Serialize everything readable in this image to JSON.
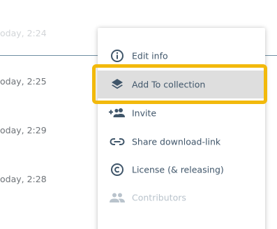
{
  "background_list": {
    "rows": [
      {
        "time": "oday, 2:24"
      },
      {
        "time": "oday, 2:25"
      },
      {
        "time": "oday, 2:29"
      },
      {
        "time": "oday, 2:28"
      }
    ]
  },
  "menu": {
    "items": [
      {
        "label": "Edit info",
        "icon": "info-circle-icon"
      },
      {
        "label": "Add To collection",
        "icon": "layers-icon"
      },
      {
        "label": "Invite",
        "icon": "add-people-icon"
      },
      {
        "label": "Share download-link",
        "icon": "link-icon"
      },
      {
        "label": "License (& releasing)",
        "icon": "copyright-icon"
      },
      {
        "label": "Contributors",
        "icon": "people-icon"
      }
    ]
  },
  "colors": {
    "menu_text": "#40566a",
    "icon": "#40566a",
    "highlight_bg": "#dedede",
    "focus_ring": "#f2b90c",
    "divider": "#6f8fa3",
    "muted_text": "#6e7378"
  }
}
